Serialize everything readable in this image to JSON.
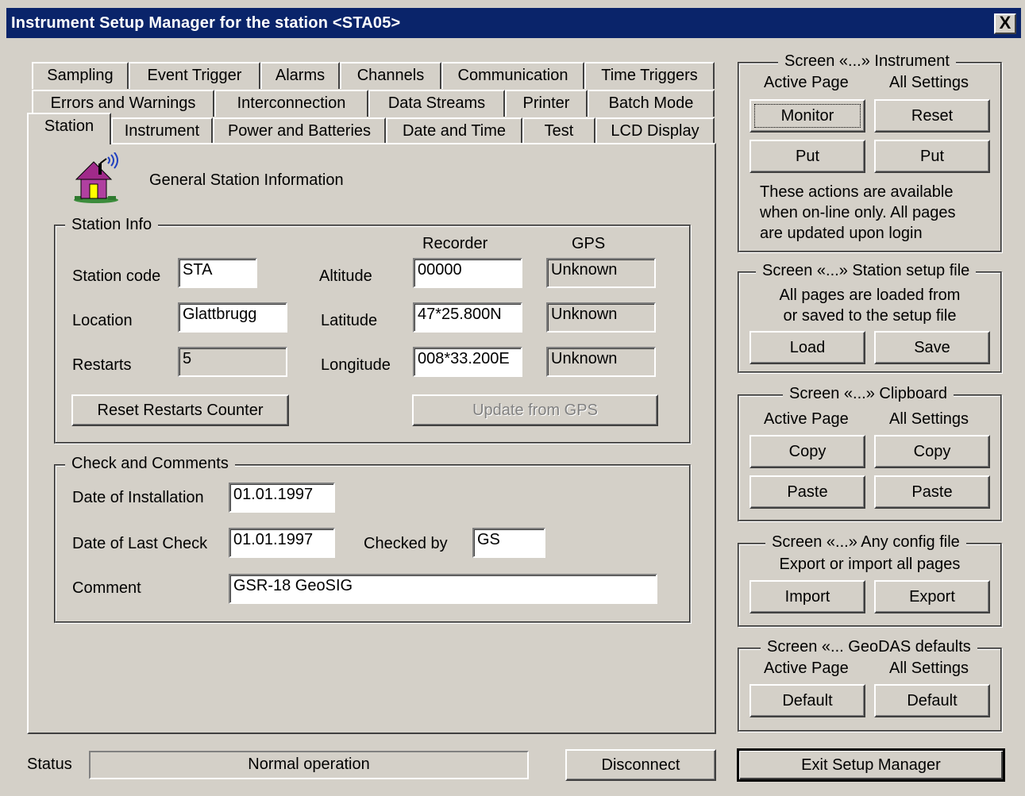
{
  "window": {
    "title": "Instrument Setup Manager for the station <STA05>",
    "close_label": "X"
  },
  "tabs": {
    "row1": [
      "Sampling",
      "Event Trigger",
      "Alarms",
      "Channels",
      "Communication",
      "Time Triggers"
    ],
    "row2": [
      "Errors and Warnings",
      "Interconnection",
      "Data Streams",
      "Printer",
      "Batch Mode"
    ],
    "row3": [
      "Station",
      "Instrument",
      "Power and Batteries",
      "Date and Time",
      "Test",
      "LCD Display"
    ],
    "active": "Station"
  },
  "page": {
    "heading": "General Station Information",
    "icon": "house-antenna-icon",
    "station_info": {
      "group_label": "Station Info",
      "col_recorder": "Recorder",
      "col_gps": "GPS",
      "station_code_label": "Station code",
      "station_code_value": "STA",
      "location_label": "Location",
      "location_value": "Glattbrugg",
      "restarts_label": "Restarts",
      "restarts_value": "5",
      "altitude_label": "Altitude",
      "altitude_value": "00000",
      "altitude_gps": "Unknown",
      "latitude_label": "Latitude",
      "latitude_value": "47*25.800N",
      "latitude_gps": "Unknown",
      "longitude_label": "Longitude",
      "longitude_value": "008*33.200E",
      "longitude_gps": "Unknown",
      "reset_button": "Reset Restarts Counter",
      "update_gps_button": "Update from GPS"
    },
    "check": {
      "group_label": "Check and Comments",
      "install_label": "Date of Installation",
      "install_value": "01.01.1997",
      "last_check_label": "Date of Last Check",
      "last_check_value": "01.01.1997",
      "checked_by_label": "Checked by",
      "checked_by_value": "GS",
      "comment_label": "Comment",
      "comment_value": "GSR-18 GeoSIG"
    }
  },
  "side": {
    "instrument": {
      "label": "Screen «...» Instrument",
      "col1": "Active Page",
      "col2": "All Settings",
      "monitor": "Monitor",
      "reset": "Reset",
      "put1": "Put",
      "put2": "Put",
      "note": [
        "These actions are available",
        "when on-line only. All pages",
        "are updated upon login"
      ]
    },
    "setup_file": {
      "label": "Screen «...» Station setup file",
      "note": [
        "All pages are loaded from",
        "or saved to the setup file"
      ],
      "load": "Load",
      "save": "Save"
    },
    "clipboard": {
      "label": "Screen «...» Clipboard",
      "col1": "Active Page",
      "col2": "All Settings",
      "copy1": "Copy",
      "copy2": "Copy",
      "paste1": "Paste",
      "paste2": "Paste"
    },
    "config": {
      "label": "Screen «...» Any config file",
      "note": "Export or import all pages",
      "import": "Import",
      "export": "Export"
    },
    "defaults": {
      "label": "Screen «... GeoDAS defaults",
      "col1": "Active Page",
      "col2": "All Settings",
      "default1": "Default",
      "default2": "Default"
    }
  },
  "bottom": {
    "status_label": "Status",
    "status_value": "Normal operation",
    "disconnect": "Disconnect",
    "exit": "Exit Setup Manager"
  }
}
